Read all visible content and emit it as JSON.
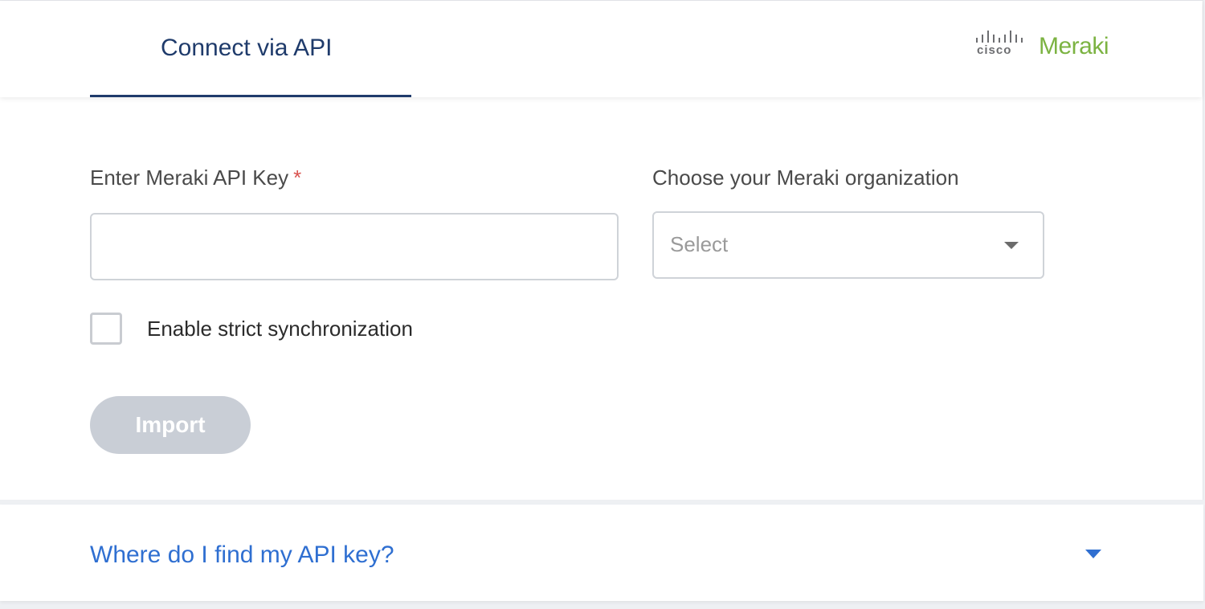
{
  "header": {
    "tab_label": "Connect via API",
    "logo": {
      "cisco_text": "cisco",
      "meraki_text": "Meraki",
      "meraki_color": "#7cb342"
    }
  },
  "form": {
    "api_key": {
      "label": "Enter Meraki API Key",
      "required_marker": "*",
      "value": "",
      "placeholder": ""
    },
    "organization": {
      "label": "Choose your Meraki organization",
      "selected": "Select",
      "icon": "caret-down-icon"
    },
    "strict_sync": {
      "label": "Enable strict synchronization",
      "checked": false
    },
    "import_button": {
      "label": "Import",
      "enabled": false
    }
  },
  "help": {
    "text": "Where do I find my API key?",
    "icon": "caret-down-icon",
    "color": "#2f6fd1"
  },
  "colors": {
    "accent": "#1f3b6b",
    "link": "#2f6fd1",
    "required": "#d9534f",
    "disabled_button": "#c9ced6"
  }
}
